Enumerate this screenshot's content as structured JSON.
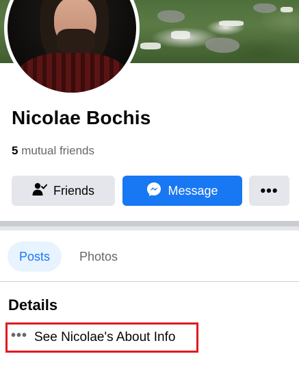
{
  "profile": {
    "name": "Nicolae Bochis",
    "mutual_count": "5",
    "mutual_label": "mutual friends"
  },
  "actions": {
    "friends_label": "Friends",
    "message_label": "Message",
    "more_label": "•••"
  },
  "tabs": [
    {
      "label": "Posts",
      "active": true
    },
    {
      "label": "Photos",
      "active": false
    }
  ],
  "details": {
    "title": "Details",
    "about_dots": "•••",
    "about_label": "See Nicolae's About Info"
  },
  "colors": {
    "accent": "#1877f2",
    "button_gray": "#e4e6eb",
    "highlight": "#e0191f"
  },
  "icons": {
    "friends": "person-check-icon",
    "message": "messenger-icon",
    "more": "more-horizontal-icon"
  }
}
